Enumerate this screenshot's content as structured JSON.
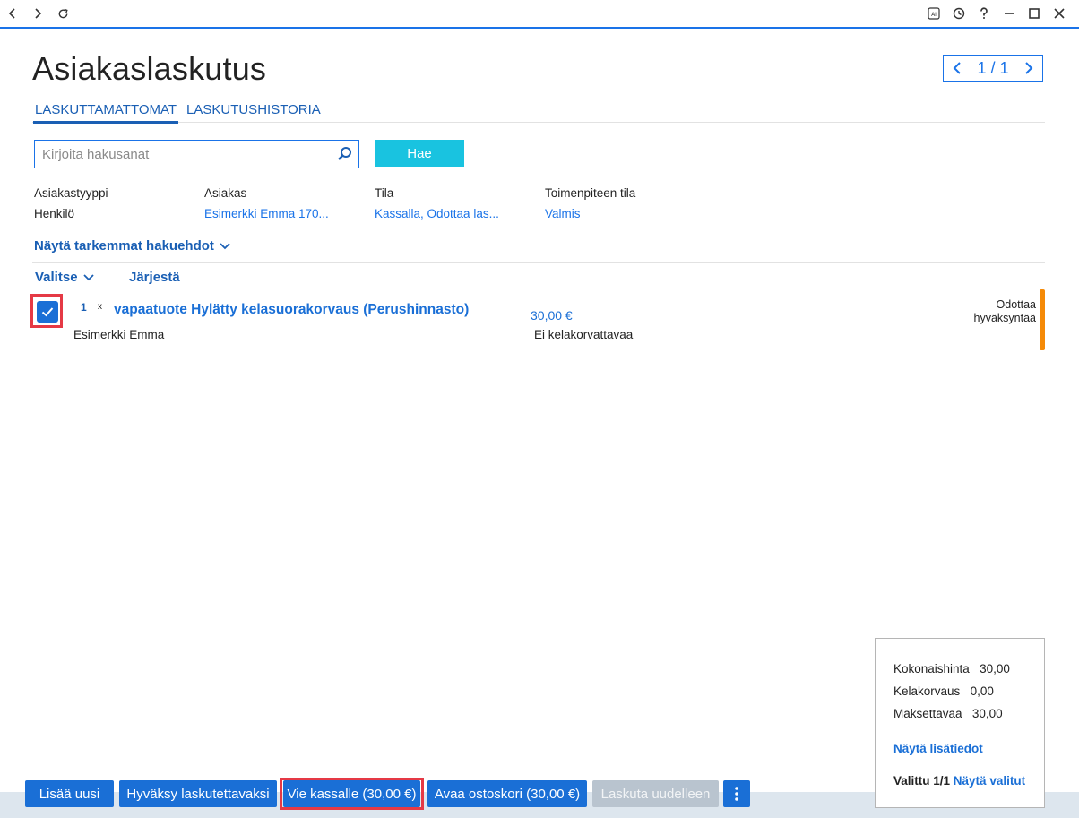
{
  "page": {
    "title": "Asiakaslaskutus",
    "pager": {
      "current": "1 / 1"
    }
  },
  "tabs": [
    {
      "label": "LASKUTTAMATTOMAT",
      "active": true
    },
    {
      "label": "LASKUTUSHISTORIA",
      "active": false
    }
  ],
  "search": {
    "placeholder": "Kirjoita hakusanat",
    "button_label": "Hae"
  },
  "filters": [
    {
      "label": "Asiakastyyppi",
      "value": "Henkilö"
    },
    {
      "label": "Asiakas",
      "value": "Esimerkki Emma 170..."
    },
    {
      "label": "Tila",
      "value": "Kassalla, Odottaa las..."
    },
    {
      "label": "Toimenpiteen tila",
      "value": "Valmis"
    }
  ],
  "more_filters_label": "Näytä tarkemmat hakuehdot",
  "list_controls": {
    "select_label": "Valitse",
    "sort_label": "Järjestä"
  },
  "items": [
    {
      "quantity": "1",
      "multiplier": "x",
      "title": "vapaatuote Hylätty kelasuorakorvaus (Perushinnasto)",
      "price": "30,00 €",
      "customer": "Esimerkki Emma",
      "kela_status": "Ei kelakorvattavaa",
      "status_line1": "Odottaa",
      "status_line2": "hyväksyntää",
      "checked": true
    }
  ],
  "summary": {
    "total_label": "Kokonaishinta",
    "total_value": "30,00",
    "kela_label": "Kelakorvaus",
    "kela_value": "0,00",
    "payable_label": "Maksettavaa",
    "payable_value": "30,00",
    "details_link": "Näytä lisätiedot",
    "selected_label": "Valittu 1/1",
    "show_selected_link": "Näytä valitut"
  },
  "actions": {
    "add_new": "Lisää uusi",
    "approve": "Hyväksy laskutettavaksi",
    "to_checkout": "Vie kassalle (30,00 €)",
    "open_cart": "Avaa ostoskori (30,00 €)",
    "reinvoice": "Laskuta uudelleen"
  },
  "colors": {
    "accent": "#1a6fd6",
    "search_button": "#19c3e0",
    "highlight": "#e53945",
    "status_pending": "#f58a07"
  }
}
